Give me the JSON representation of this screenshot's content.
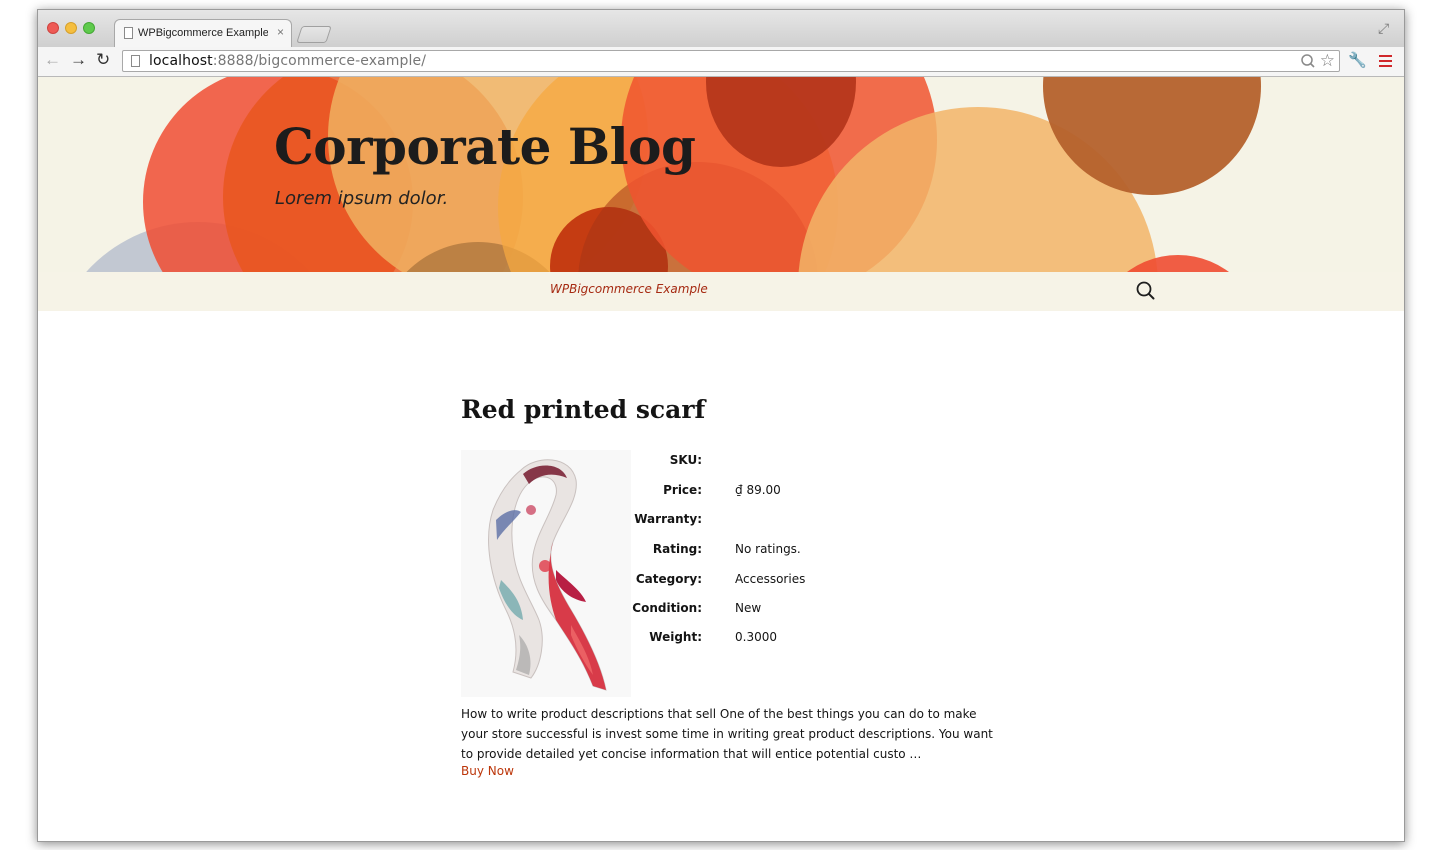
{
  "browser": {
    "tab_title": "WPBigcommerce Example",
    "url_host": "localhost",
    "url_rest": ":8888/bigcommerce-example/"
  },
  "site": {
    "title": "Corporate Blog",
    "description": "Lorem ipsum dolor.",
    "nav_link": "WPBigcommerce Example"
  },
  "post": {
    "title": "Red printed scarf",
    "details": [
      {
        "label": "SKU:",
        "value": ""
      },
      {
        "label": "Price:",
        "value": "₫ 89.00"
      },
      {
        "label": "Warranty:",
        "value": ""
      },
      {
        "label": "Rating:",
        "value": "No ratings."
      },
      {
        "label": "Category:",
        "value": "Accessories"
      },
      {
        "label": "Condition:",
        "value": "New"
      },
      {
        "label": "Weight:",
        "value": "0.3000"
      }
    ],
    "description": "How to write product descriptions that sell One of the best things you can do to make your store successful is invest some time in writing great product descriptions. You want to provide detailed yet concise information that will entice potential custo …",
    "buy_link": "Buy Now"
  },
  "colors": {
    "link": "#bc360a",
    "header_bg": "#f5f3e6"
  }
}
